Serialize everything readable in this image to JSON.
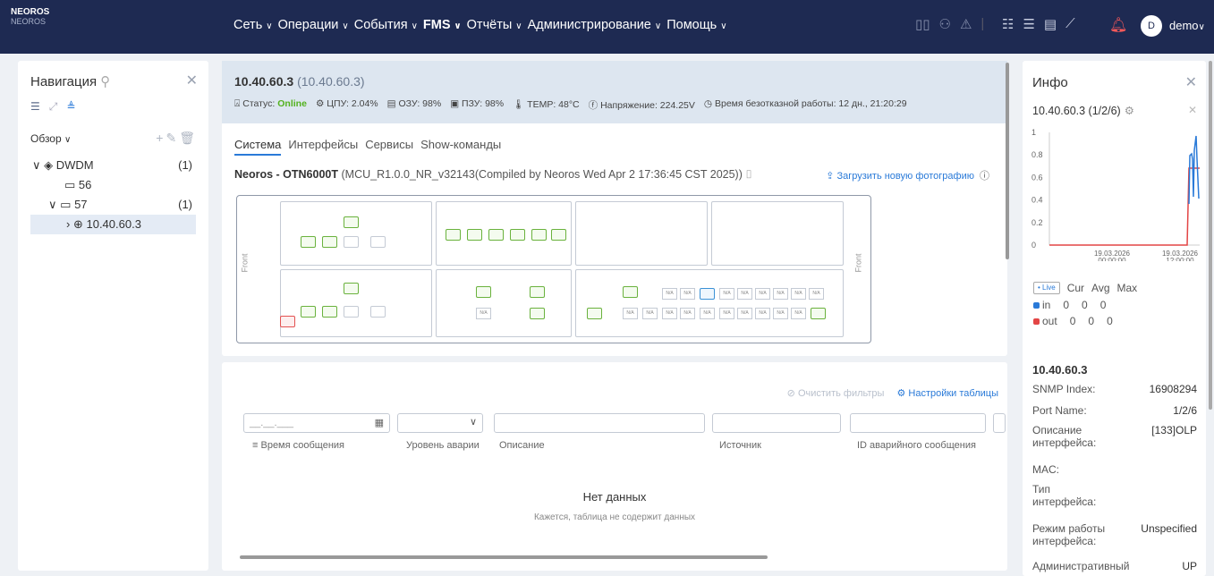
{
  "brand": {
    "name": "NEOROS",
    "sub": "NEOROS"
  },
  "menu": [
    "Сеть",
    "Операции",
    "События",
    "FMS",
    "Отчёты",
    "Администрирование",
    "Помощь"
  ],
  "user": {
    "initial": "D",
    "name": "demo"
  },
  "nav": {
    "title": "Навигация",
    "overview": "Обзор",
    "tree": [
      {
        "label": "DWDM",
        "count": "(1)"
      },
      {
        "label": "56",
        "count": ""
      },
      {
        "label": "57",
        "count": "(1)"
      },
      {
        "label": "10.40.60.3",
        "count": ""
      }
    ]
  },
  "device": {
    "ip": "10.40.60.3",
    "ip_paren": "(10.40.60.3)",
    "status_label": "Статус:",
    "status": "Online",
    "cpu": "ЦПУ: 2.04%",
    "ram": "ОЗУ: 98%",
    "rom": "ПЗУ: 98%",
    "temp": "TEMP: 48°C",
    "voltage": "Напряжение: 224.25V",
    "uptime": "Время безотказной работы: 12 дн., 21:20:29",
    "tabs": [
      "Система",
      "Интерфейсы",
      "Сервисы",
      "Show-команды"
    ],
    "model": "Neoros - OTN6000T",
    "firmware": "(MCU_R1.0.0_NR_v32143(Compiled by Neoros Wed Apr 2 17:36:45 CST 2025))",
    "upload": "Загрузить новую фотографию",
    "front": "Front"
  },
  "alarm": {
    "clear_filters": "Очистить фильтры",
    "table_settings": "Настройки таблицы",
    "date_placeholder": "__.__.___",
    "columns": [
      "Время сообщения",
      "Уровень аварии",
      "Описание",
      "Источник",
      "ID аварийного сообщения"
    ],
    "no_data": "Нет данных",
    "no_data_sub": "Кажется, таблица не содержит данных"
  },
  "info": {
    "title": "Инфо",
    "port": "10.40.60.3 (1/2/6)",
    "chart_data": {
      "type": "line",
      "y_ticks": [
        "1",
        "0.8",
        "0.6",
        "0.4",
        "0.2",
        "0"
      ],
      "x_ticks": [
        "19.03.2026 00:00:00",
        "19.03.2026 12:00:00"
      ],
      "series": [
        {
          "name": "in",
          "color": "#2a7ad8"
        },
        {
          "name": "out",
          "color": "#e34545"
        }
      ]
    },
    "legend": {
      "live": "• Live",
      "cols": [
        "Cur",
        "Avg",
        "Max"
      ],
      "in": [
        "in",
        "0",
        "0",
        "0"
      ],
      "out": [
        "out",
        "0",
        "0",
        "0"
      ]
    },
    "host": "10.40.60.3",
    "props": [
      {
        "k": "SNMP Index:",
        "v": "16908294"
      },
      {
        "k": "Port Name:",
        "v": "1/2/6"
      },
      {
        "k": "Описание интерфейса:",
        "v": "[133]OLP"
      },
      {
        "k": "MAC:",
        "v": ""
      },
      {
        "k": "Тип интерфейса:",
        "v": ""
      },
      {
        "k": "Режим работы интерфейса:",
        "v": "Unspecified"
      },
      {
        "k": "Административный",
        "v": "UP"
      }
    ]
  }
}
